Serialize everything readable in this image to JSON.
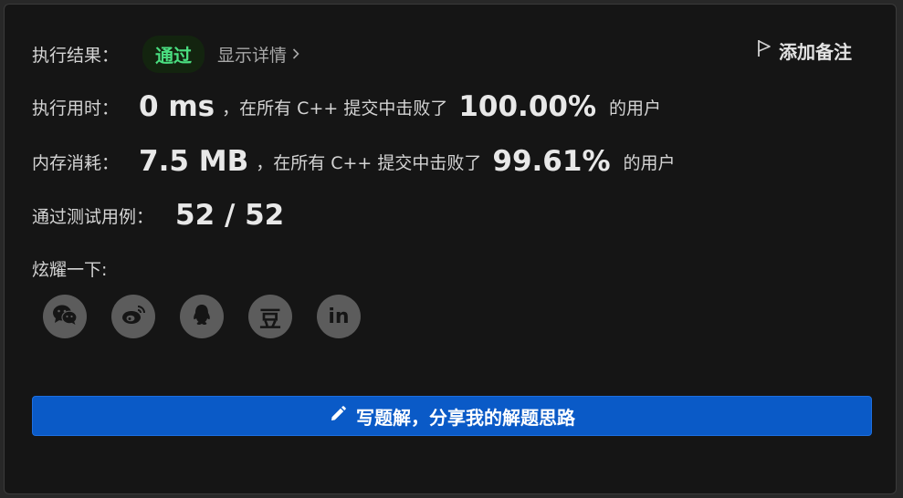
{
  "result": {
    "label": "执行结果：",
    "status": "通过",
    "details": "显示详情",
    "add_note": "添加备注"
  },
  "runtime": {
    "label": "执行用时：",
    "value": "0 ms",
    "middle": "，在所有 C++ 提交中击败了",
    "percent": "100.00%",
    "suffix": "的用户"
  },
  "memory": {
    "label": "内存消耗：",
    "value": "7.5 MB",
    "middle": "，在所有 C++ 提交中击败了",
    "percent": "99.61%",
    "suffix": "的用户"
  },
  "testcases": {
    "label": "通过测试用例：",
    "value": "52 / 52"
  },
  "share": {
    "label": "炫耀一下:",
    "icons": [
      "wechat-icon",
      "weibo-icon",
      "qq-icon",
      "douban-icon",
      "linkedin-icon"
    ],
    "douban_glyph": "豆",
    "linkedin_glyph": "in"
  },
  "solution_button": "写题解，分享我的解题思路",
  "colors": {
    "accent_blue": "#0a5ac7",
    "status_green": "#4ade80",
    "icon_bg": "#5c5c5c"
  }
}
